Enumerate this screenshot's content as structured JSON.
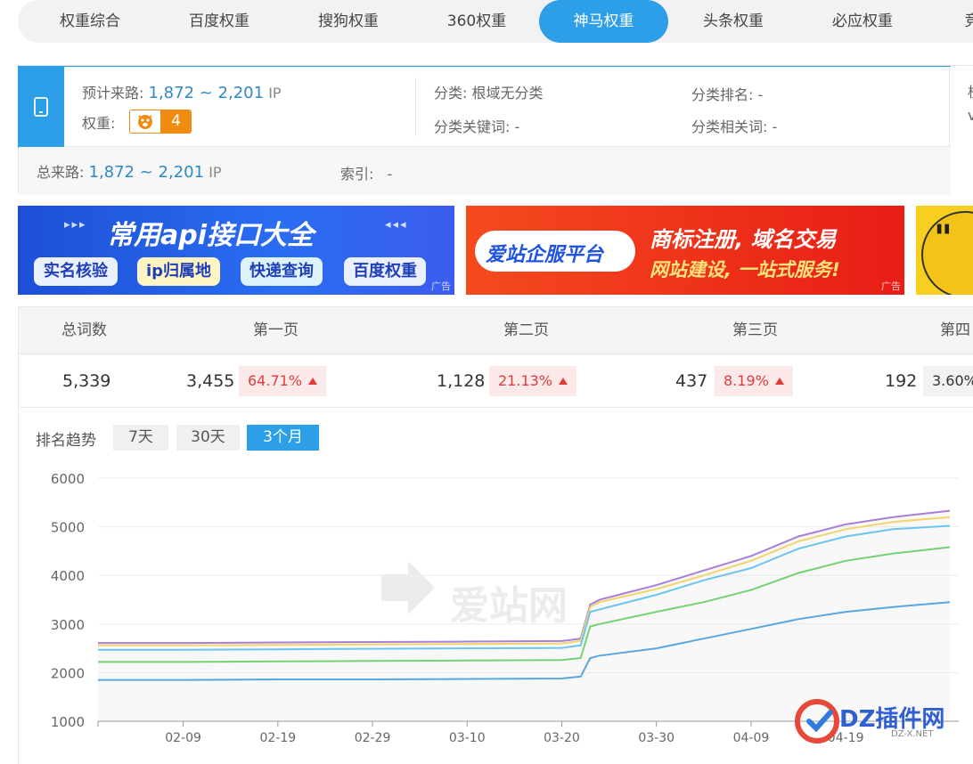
{
  "tabs": [
    {
      "label": "权重综合",
      "active": false
    },
    {
      "label": "百度权重",
      "active": false
    },
    {
      "label": "搜狗权重",
      "active": false
    },
    {
      "label": "360权重",
      "active": false
    },
    {
      "label": "神马权重",
      "active": true
    },
    {
      "label": "头条权重",
      "active": false
    },
    {
      "label": "必应权重",
      "active": false
    },
    {
      "label": "竞",
      "active": false
    }
  ],
  "info": {
    "traffic_label": "预计来路:",
    "traffic_value": "1,872 ~ 2,201",
    "traffic_unit": "IP",
    "weight_label": "权重:",
    "weight_value": "4",
    "category_label": "分类:",
    "category_value": "根域无分类",
    "category_keyword_label": "分类关键词:",
    "category_keyword_value": "-",
    "category_rank_label": "分类排名:",
    "category_rank_value": "-",
    "category_related_label": "分类相关词:",
    "category_related_value": "-",
    "total_label": "总来路:",
    "total_value": "1,872 ~ 2,201",
    "total_unit": "IP",
    "index_label": "索引:",
    "index_value": "-",
    "right_cut_1": "桂",
    "right_cut_2": "v"
  },
  "ads": {
    "ad1_title": "常用api接口大全",
    "ad1_chips": [
      "实名核验",
      "ip归属地",
      "快递查询",
      "百度权重"
    ],
    "ad1_tag": "广告",
    "ad2_left": "爱站企服平台",
    "ad2_line1": "商标注册, 域名交易",
    "ad2_line2": "网站建设, 一站式服务!",
    "ad2_tag": "广告"
  },
  "table": {
    "headers": [
      "总词数",
      "第一页",
      "第二页",
      "第三页",
      "第四"
    ],
    "total": "5,339",
    "cols": [
      {
        "count": "3,455",
        "pct": "64.71%",
        "up": true
      },
      {
        "count": "1,128",
        "pct": "21.13%",
        "up": true
      },
      {
        "count": "437",
        "pct": "8.19%",
        "up": true
      },
      {
        "count": "192",
        "pct": "3.60%",
        "up": false
      }
    ]
  },
  "trend": {
    "label": "排名趋势",
    "buttons": [
      {
        "label": "7天",
        "active": false
      },
      {
        "label": "30天",
        "active": false
      },
      {
        "label": "3个月",
        "active": true
      }
    ]
  },
  "watermark": "爱站网",
  "dz_logo": "DZ插件网",
  "dz_sub": "DZ-X.NET",
  "colors": {
    "accent": "#2d9fe8",
    "up_red": "#e03c3c",
    "badge_orange": "#f08c12"
  },
  "chart_data": {
    "type": "line",
    "x_ticks": [
      "02-09",
      "02-19",
      "02-29",
      "03-10",
      "03-20",
      "03-30",
      "04-09",
      "04-19"
    ],
    "y_ticks": [
      1000,
      2000,
      3000,
      4000,
      5000,
      6000
    ],
    "ylim": [
      1000,
      6000
    ],
    "x": [
      "01-31",
      "02-09",
      "02-19",
      "02-29",
      "03-10",
      "03-20",
      "03-22",
      "03-23",
      "03-24",
      "03-30",
      "04-04",
      "04-09",
      "04-14",
      "04-19",
      "04-24",
      "04-30"
    ],
    "series": [
      {
        "color": "#a97fd8",
        "values": [
          2610,
          2610,
          2620,
          2630,
          2640,
          2650,
          2700,
          3400,
          3500,
          3800,
          4100,
          4400,
          4800,
          5050,
          5200,
          5330
        ]
      },
      {
        "color": "#f3d46a",
        "values": [
          2560,
          2560,
          2570,
          2580,
          2590,
          2600,
          2650,
          3350,
          3450,
          3720,
          4000,
          4300,
          4700,
          4950,
          5100,
          5200
        ]
      },
      {
        "color": "#6cc4f0",
        "values": [
          2470,
          2470,
          2480,
          2490,
          2500,
          2510,
          2560,
          3250,
          3300,
          3600,
          3900,
          4150,
          4550,
          4800,
          4950,
          5020
        ]
      },
      {
        "color": "#74d274",
        "values": [
          2220,
          2220,
          2230,
          2240,
          2250,
          2260,
          2300,
          2950,
          3000,
          3250,
          3450,
          3700,
          4050,
          4300,
          4450,
          4580
        ]
      },
      {
        "color": "#5aa6e0",
        "values": [
          1850,
          1850,
          1860,
          1860,
          1870,
          1880,
          1920,
          2300,
          2350,
          2500,
          2700,
          2900,
          3100,
          3250,
          3350,
          3450
        ]
      }
    ]
  }
}
